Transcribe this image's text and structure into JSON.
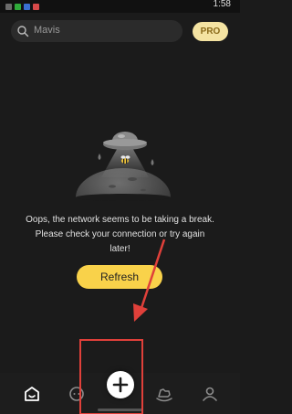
{
  "status_bar": {
    "time": "1:58"
  },
  "search": {
    "placeholder": "Mavis"
  },
  "pro_badge": "PRO",
  "error": {
    "line1": "Oops, the network seems to be taking a break.",
    "line2": "Please check your connection or try again",
    "line3": "later!"
  },
  "refresh_label": "Refresh",
  "nav": [
    {
      "name": "home",
      "icon": "home-icon"
    },
    {
      "name": "chat",
      "icon": "chat-icon"
    },
    {
      "name": "create",
      "icon": "plus-icon"
    },
    {
      "name": "discover",
      "icon": "rocking-horse-icon"
    },
    {
      "name": "profile",
      "icon": "person-icon"
    }
  ],
  "colors": {
    "background": "#1b1b1b",
    "accent_yellow": "#f9d24a",
    "pro_badge_bg": "#f4e3a2",
    "annotation_red": "#e0403a"
  }
}
